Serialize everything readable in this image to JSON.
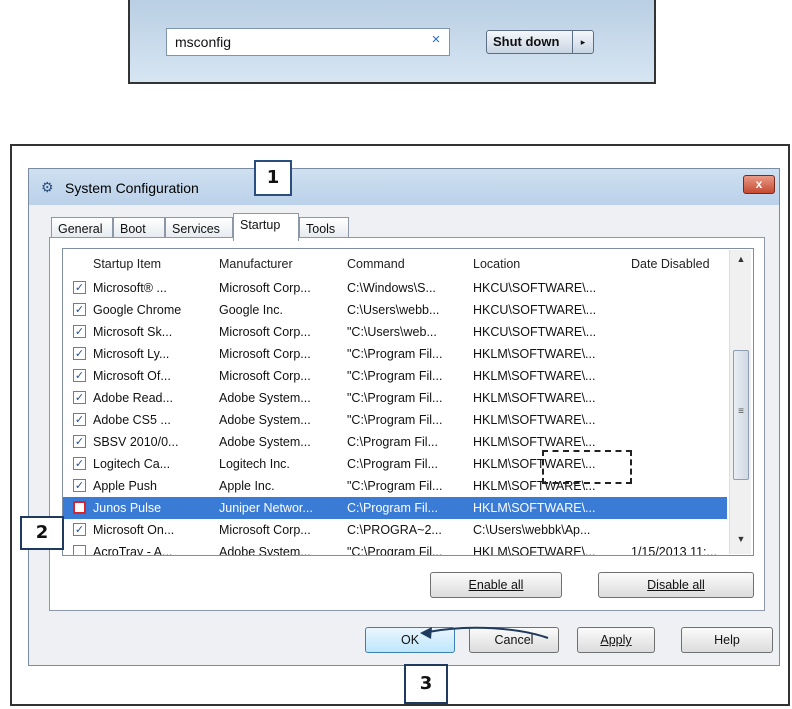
{
  "search": {
    "value": "msconfig",
    "clear_icon": "×",
    "shutdown_label": "Shut down",
    "arrow_icon": "▸"
  },
  "dialog": {
    "title": "System Configuration",
    "close_label": "x",
    "tabs": [
      {
        "label": "General"
      },
      {
        "label": "Boot"
      },
      {
        "label": "Services"
      },
      {
        "label": "Startup",
        "active": true
      },
      {
        "label": "Tools"
      }
    ],
    "columns": [
      "Startup Item",
      "Manufacturer",
      "Command",
      "Location",
      "Date Disabled"
    ],
    "rows": [
      {
        "checked": true,
        "item": "Microsoft® ...",
        "manufacturer": "Microsoft Corp...",
        "command": "C:\\Windows\\S...",
        "location": "HKCU\\SOFTWARE\\...",
        "date": ""
      },
      {
        "checked": true,
        "item": "Google Chrome",
        "manufacturer": "Google Inc.",
        "command": "C:\\Users\\webb...",
        "location": "HKCU\\SOFTWARE\\...",
        "date": ""
      },
      {
        "checked": true,
        "item": "Microsoft Sk...",
        "manufacturer": "Microsoft Corp...",
        "command": "\"C:\\Users\\web...",
        "location": "HKCU\\SOFTWARE\\...",
        "date": ""
      },
      {
        "checked": true,
        "item": "Microsoft Ly...",
        "manufacturer": "Microsoft Corp...",
        "command": "\"C:\\Program Fil...",
        "location": "HKLM\\SOFTWARE\\...",
        "date": ""
      },
      {
        "checked": true,
        "item": "Microsoft Of...",
        "manufacturer": "Microsoft Corp...",
        "command": "\"C:\\Program Fil...",
        "location": "HKLM\\SOFTWARE\\...",
        "date": ""
      },
      {
        "checked": true,
        "item": "Adobe Read...",
        "manufacturer": "Adobe System...",
        "command": "\"C:\\Program Fil...",
        "location": "HKLM\\SOFTWARE\\...",
        "date": ""
      },
      {
        "checked": true,
        "item": "Adobe CS5 ...",
        "manufacturer": "Adobe System...",
        "command": "\"C:\\Program Fil...",
        "location": "HKLM\\SOFTWARE\\...",
        "date": ""
      },
      {
        "checked": true,
        "item": "SBSV 2010/0...",
        "manufacturer": "Adobe System...",
        "command": "C:\\Program Fil...",
        "location": "HKLM\\SOFTWARE\\...",
        "date": ""
      },
      {
        "checked": true,
        "item": "Logitech Ca...",
        "manufacturer": "Logitech Inc.",
        "command": "C:\\Program Fil...",
        "location": "HKLM\\SOFTWARE\\...",
        "date": ""
      },
      {
        "checked": true,
        "item": "Apple Push",
        "manufacturer": "Apple Inc.",
        "command": "\"C:\\Program Fil...",
        "location": "HKLM\\SOFTWARE\\...",
        "date": ""
      },
      {
        "checked": false,
        "selected": true,
        "item": "Junos Pulse",
        "manufacturer": "Juniper Networ...",
        "command": "C:\\Program Fil...",
        "location": "HKLM\\SOFTWARE\\...",
        "date": ""
      },
      {
        "checked": true,
        "item": "Microsoft On...",
        "manufacturer": "Microsoft Corp...",
        "command": "C:\\PROGRA~2...",
        "location": "C:\\Users\\webbk\\Ap...",
        "date": ""
      },
      {
        "checked": false,
        "item": "AcroTray - A...",
        "manufacturer": "Adobe System...",
        "command": "\"C:\\Program Fil...",
        "location": "HKLM\\SOFTWARE\\...",
        "date": "1/15/2013 11:..."
      }
    ],
    "enable_all": "Enable all",
    "disable_all": "Disable all",
    "ok": "OK",
    "cancel": "Cancel",
    "apply": "Apply",
    "help": "Help"
  },
  "callouts": {
    "one": "1",
    "two": "2",
    "three": "3"
  },
  "colors": {
    "selection": "#3a7bd5",
    "highlight_box": "#d8252b",
    "callout_border": "#1f3a5f"
  }
}
